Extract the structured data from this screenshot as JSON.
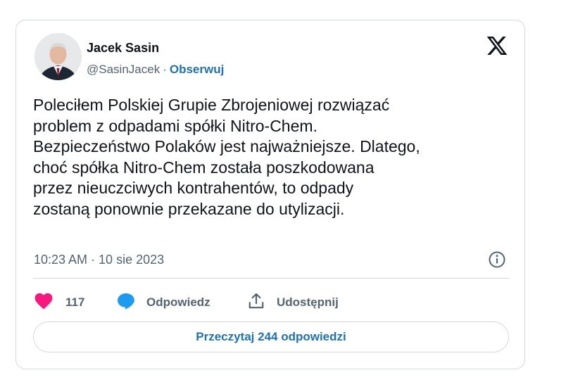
{
  "author": {
    "name": "Jacek Sasin",
    "handle": "@SasinJacek",
    "separator": "·",
    "follow_label": "Obserwuj"
  },
  "platform_icon": "x-logo-icon",
  "tweet": {
    "text": "Poleciłem Polskiej Grupie Zbrojeniowej rozwiązać\nproblem z odpadami spółki Nitro-Chem.\nBezpieczeństwo Polaków jest najważniejsze. Dlatego,\nchoć spółka Nitro-Chem została poszkodowana\nprzez nieuczciwych kontrahentów, to odpady\nzostaną ponownie przekazane do utylizacji.",
    "timestamp": "10:23 AM · 10 sie 2023"
  },
  "actions": {
    "like_count": "117",
    "reply_label": "Odpowiedz",
    "share_label": "Udostępnij"
  },
  "read_replies_label": "Przeczytaj 244 odpowiedzi",
  "colors": {
    "like": "#f91880",
    "reply": "#1d9bf0",
    "link": "#1d72b8",
    "secondary_text": "#536471",
    "border": "#cfd9de"
  }
}
